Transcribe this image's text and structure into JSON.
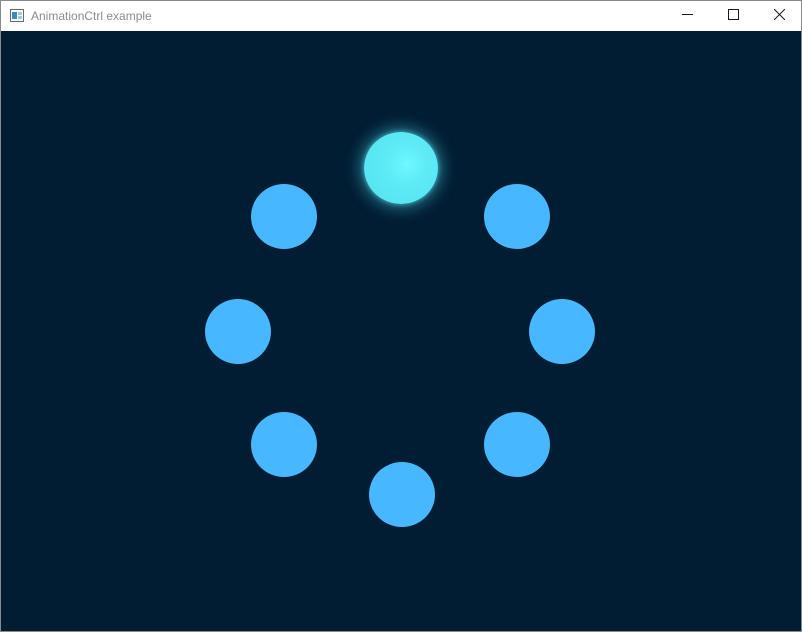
{
  "window": {
    "title": "AnimationCtrl example"
  },
  "icons": {
    "app": "app-window-icon",
    "minimize": "minimize-icon",
    "maximize": "maximize-icon",
    "close": "close-icon"
  },
  "canvas": {
    "background": "#011d33"
  },
  "animation": {
    "dot_count": 8,
    "active_index": 0,
    "dot_color": "#47b8ff",
    "active_color": "#5eeaf8"
  }
}
